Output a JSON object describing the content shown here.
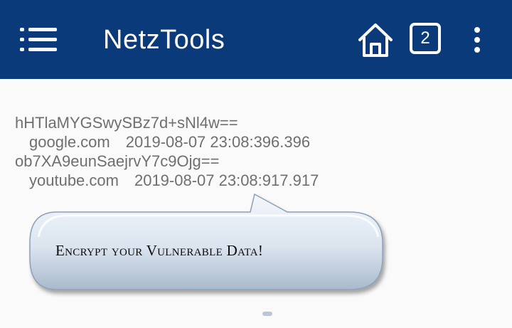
{
  "appbar": {
    "title": "NetzTools",
    "tab_count": "2",
    "icons": [
      "menu-icon",
      "home-icon",
      "tabs-icon",
      "overflow-menu-icon"
    ],
    "color": "#0b3a7a"
  },
  "entries": [
    {
      "hash": "hHTlaMYGSwySBz7d+sNl4w==",
      "site": "google.com",
      "timestamp": "2019-08-07 23:08:396.396"
    },
    {
      "hash": "ob7XA9eunSaejrvY7c9Ojg==",
      "site": "youtube.com",
      "timestamp": "2019-08-07 23:08:917.917"
    }
  ],
  "callout": {
    "text": "Encrypt your Vulnerable Data!"
  }
}
